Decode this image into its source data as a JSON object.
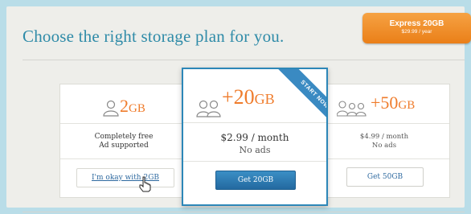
{
  "headline": "Choose the right storage plan for you.",
  "express": {
    "title": "Express 20GB",
    "price": "$29.99 / year"
  },
  "plans": [
    {
      "amount": "2",
      "unit": "GB",
      "line1": "Completely free",
      "line2": "Ad supported",
      "button": "I'm okay with 2GB"
    },
    {
      "amount": "+20",
      "unit": "GB",
      "line1": "$2.99 / month",
      "line2": "No ads",
      "button": "Get 20GB",
      "ribbon": "START NOW!"
    },
    {
      "amount": "+50",
      "unit": "GB",
      "line1": "$4.99 / month",
      "line2": "No ads",
      "button": "Get 50GB"
    }
  ],
  "colors": {
    "accent_orange": "#ef7c2c",
    "brand_blue": "#2d87b8",
    "headline_blue": "#2f8ba8",
    "background": "#b9dde8"
  },
  "icons": [
    "person-icon",
    "people-group-icon",
    "hand-cursor-icon"
  ]
}
